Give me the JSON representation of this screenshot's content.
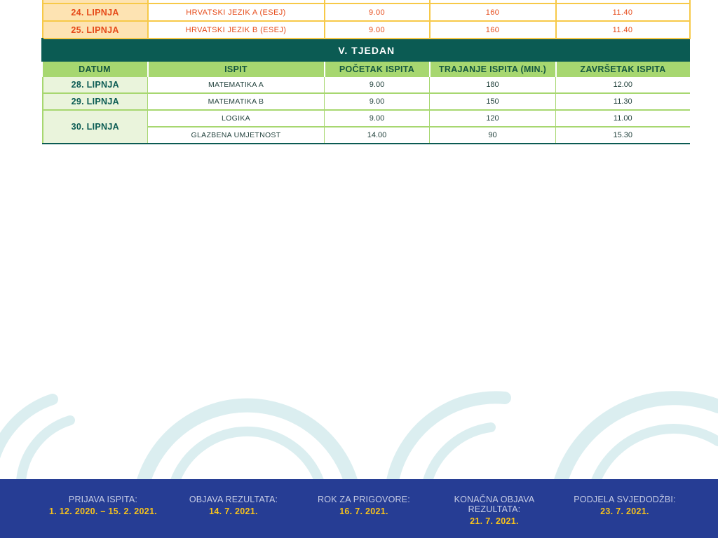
{
  "week4_tail": [
    {
      "date": "",
      "exam": "",
      "start": "",
      "duration": "",
      "end": ""
    },
    {
      "date": "24. LIPNJA",
      "exam": "HRVATSKI JEZIK A (ESEJ)",
      "start": "9.00",
      "duration": "160",
      "end": "11.40"
    },
    {
      "date": "25. LIPNJA",
      "exam": "HRVATSKI JEZIK B (ESEJ)",
      "start": "9.00",
      "duration": "160",
      "end": "11.40"
    }
  ],
  "week5": {
    "title": "V. TJEDAN",
    "headers": [
      "DATUM",
      "ISPIT",
      "POČETAK ISPITA",
      "TRAJANJE ISPITA (MIN.)",
      "ZAVRŠETAK ISPITA"
    ],
    "rows": [
      {
        "date": "28. LIPNJA",
        "exam": "MATEMATIKA A",
        "start": "9.00",
        "duration": "180",
        "end": "12.00"
      },
      {
        "date": "29. LIPNJA",
        "exam": "MATEMATIKA B",
        "start": "9.00",
        "duration": "150",
        "end": "11.30"
      },
      {
        "date": "30. LIPNJA",
        "exam": "LOGIKA",
        "start": "9.00",
        "duration": "120",
        "end": "11.00"
      },
      {
        "date": "",
        "exam": "GLAZBENA UMJETNOST",
        "start": "14.00",
        "duration": "90",
        "end": "15.30"
      }
    ]
  },
  "footer": [
    {
      "label": "PRIJAVA ISPITA:",
      "value": "1. 12. 2020. – 15. 2. 2021."
    },
    {
      "label": "OBJAVA REZULTATA:",
      "value": "14. 7. 2021."
    },
    {
      "label": "ROK ZA PRIGOVORE:",
      "value": "16. 7. 2021."
    },
    {
      "label": "KONAČNA OBJAVA REZULTATA:",
      "value": "21. 7. 2021."
    },
    {
      "label": "PODJELA SVJEDODŽBI:",
      "value": "23. 7. 2021."
    }
  ],
  "colors": {
    "dark_teal": "#0b5b53",
    "light_green": "#a7d770",
    "orange_text": "#e64a19",
    "footer_bg": "#263d94",
    "footer_value": "#f7c21c"
  }
}
